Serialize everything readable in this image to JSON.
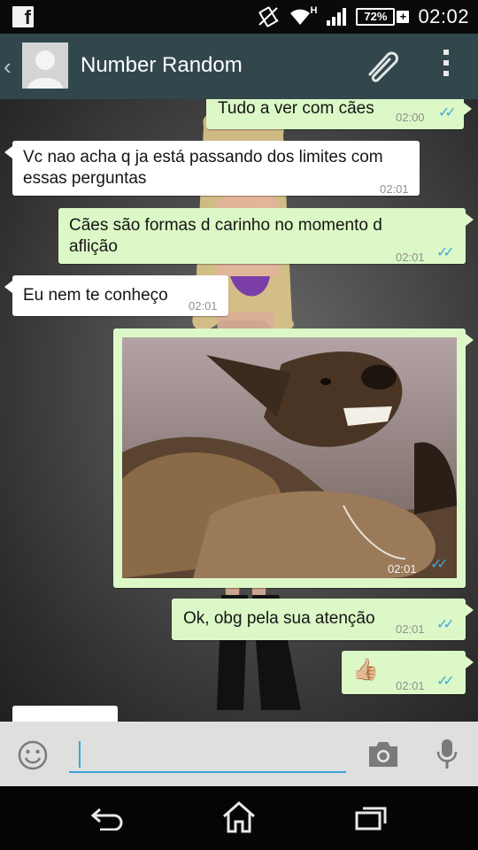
{
  "status_bar": {
    "app_icon_letter": "f",
    "network_label": "H",
    "battery_percent": "72%",
    "battery_level": 0.72,
    "charging_symbol": "+",
    "clock": "02:02"
  },
  "header": {
    "back_symbol": "‹",
    "contact_name": "Number Random",
    "icons": [
      "avatar",
      "paperclip-icon",
      "overflow-menu-icon"
    ]
  },
  "messages": [
    {
      "direction": "out",
      "text": "Tudo a ver com cães",
      "time": "02:00",
      "ticks": "✓✓"
    },
    {
      "direction": "in",
      "text": "Vc nao acha q ja está passando dos limites com essas perguntas",
      "time": "02:01"
    },
    {
      "direction": "out",
      "text": "Cães são formas d carinho no momento d aflição",
      "time": "02:01",
      "ticks": "✓✓"
    },
    {
      "direction": "in",
      "text": "Eu nem te conheço",
      "time": "02:01"
    },
    {
      "direction": "out",
      "type": "photo",
      "time": "02:01",
      "ticks": "✓✓"
    },
    {
      "direction": "out",
      "text": "Ok, obg pela sua atenção",
      "time": "02:01",
      "ticks": "✓✓"
    },
    {
      "direction": "out",
      "emoji": "👍🏼",
      "time": "02:01",
      "ticks": "✓✓"
    }
  ],
  "input_bar": {
    "placeholder": "",
    "icons": [
      "emoji-icon",
      "camera-icon",
      "microphone-icon"
    ]
  },
  "nav_bar": {
    "icons": [
      "back-icon",
      "home-icon",
      "recent-apps-icon"
    ]
  },
  "colors": {
    "header_bg": "#32474c",
    "out_bubble": "#dcf8c6",
    "in_bubble": "#ffffff",
    "read_ticks": "#3fa9e0",
    "accent": "#3aa3d6"
  }
}
